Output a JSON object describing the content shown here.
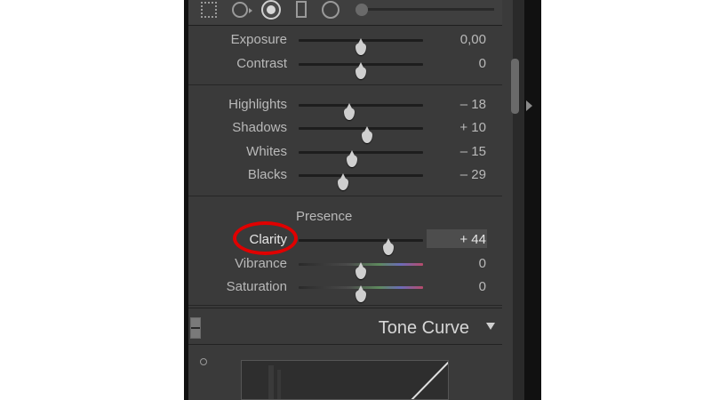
{
  "toolbar": {
    "tools": [
      "grid-overlay",
      "crop",
      "spot-removal",
      "graduated-filter",
      "radial-filter",
      "adjustment-brush"
    ]
  },
  "basic": {
    "rows_tone": [
      {
        "label": "Exposure",
        "value": "0,00",
        "level": 0.5
      },
      {
        "label": "Contrast",
        "value": "0",
        "level": 0.5
      }
    ],
    "rows_tonal": [
      {
        "label": "Highlights",
        "value": "– 18",
        "level": 0.41
      },
      {
        "label": "Shadows",
        "value": "+ 10",
        "level": 0.55
      },
      {
        "label": "Whites",
        "value": "– 15",
        "level": 0.43
      },
      {
        "label": "Blacks",
        "value": "– 29",
        "level": 0.36
      }
    ],
    "presence": {
      "title": "Presence",
      "rows": [
        {
          "label": "Clarity",
          "value": "+ 44",
          "level": 0.72
        },
        {
          "label": "Vibrance",
          "value": "0",
          "level": 0.5
        },
        {
          "label": "Saturation",
          "value": "0",
          "level": 0.5
        }
      ]
    }
  },
  "tone_curve": {
    "title": "Tone Curve"
  },
  "colors": {
    "highlight_ring": "#e00000",
    "panel_bg": "#3a3a3a",
    "text": "#b9b9b9"
  }
}
